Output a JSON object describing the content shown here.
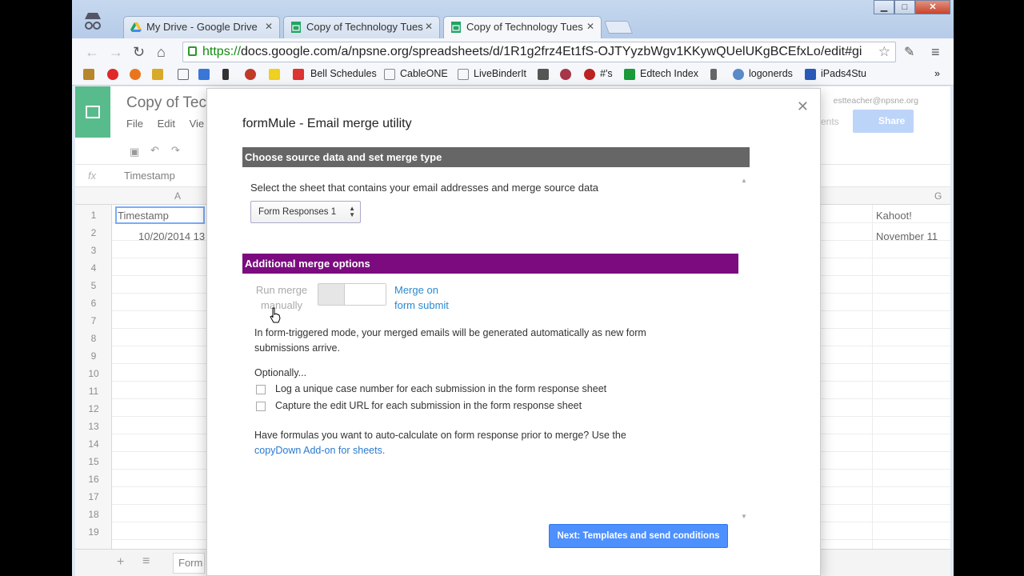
{
  "browser": {
    "tabs": [
      {
        "label": "My Drive - Google Drive",
        "icon": "google-drive-icon"
      },
      {
        "label": "Copy of Technology Tues",
        "icon": "sheets-icon"
      },
      {
        "label": "Copy of Technology Tues",
        "icon": "sheets-icon"
      }
    ],
    "url_scheme": "https://",
    "url_rest": "docs.google.com/a/npsne.org/spreadsheets/d/1R1g2frz4Et1fS-OJTYyzbWgv1KKywQUelUKgBCEfxLo/edit#gi",
    "bookmarks": [
      "Bell Schedules",
      "CableONE",
      "LiveBinderIt",
      "#'s",
      "Edtech Index",
      "logonerds",
      "iPads4Stu"
    ],
    "bookmarks_more": "»"
  },
  "sheet": {
    "title": "Copy of Tec",
    "menus": [
      "File",
      "Edit",
      "Vie"
    ],
    "formula_value": "Timestamp",
    "col_a": "A",
    "col_g": "G",
    "rows": [
      "1",
      "2",
      "3",
      "4",
      "5",
      "6",
      "7",
      "8",
      "9",
      "10",
      "11",
      "12",
      "13",
      "14",
      "15",
      "16",
      "17",
      "18",
      "19"
    ],
    "a1": "Timestamp",
    "a2": "10/20/2014 13",
    "g1": "Kahoot!",
    "g2": "November 11",
    "account": "estteacher@npsne.org",
    "share": "Share",
    "comments": "ents",
    "sheet_tab": "Form"
  },
  "dialog": {
    "title": "formMule - Email merge utility",
    "section1": "Choose source data and set merge type",
    "section1_color": "#666666",
    "select_label": "Select the sheet that contains your email addresses and merge source data",
    "select_value": "Form Responses 1",
    "section2": "Additional merge options",
    "section2_color": "#7b0b7f",
    "toggle_left": "Run merge manually",
    "toggle_right": "Merge on form submit",
    "mode_text": "In form-triggered mode, your merged emails will be generated automatically as new form submissions arrive.",
    "optionally": "Optionally...",
    "option1": "Log a unique case number for each submission in the form response sheet",
    "option2": "Capture the edit URL for each submission in the form response sheet",
    "formulas_text": "Have formulas you want to auto-calculate on form response prior to merge? Use the",
    "formulas_link": "copyDown Add-on for sheets.",
    "next_button": "Next: Templates and send conditions"
  }
}
